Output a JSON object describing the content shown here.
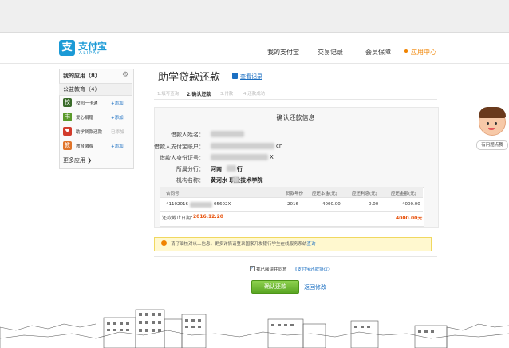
{
  "brand": {
    "logo_glyph": "支",
    "name": "支付宝",
    "sub": "ALIPAY",
    "color": "#1b9ad6"
  },
  "nav": [
    {
      "label": "我的支付宝"
    },
    {
      "label": "交易记录"
    },
    {
      "label": "会员保障"
    },
    {
      "label": "应用中心"
    }
  ],
  "sidebar": {
    "title": "我的应用（8）",
    "section": "公益教育（4）",
    "apps": [
      {
        "name": "校园一卡通",
        "action": "+添加",
        "icon": "card-icon",
        "color": "#3a6b2a",
        "glyph": "校"
      },
      {
        "name": "爱心捐赠",
        "action": "+添加",
        "icon": "book-icon",
        "color": "#5a9a2a",
        "glyph": "书"
      },
      {
        "name": "助学贷款还款",
        "action": "已添加",
        "icon": "heart-icon",
        "color": "#d23b2b",
        "glyph": "♥"
      },
      {
        "name": "教育缴费",
        "action": "+添加",
        "icon": "education-icon",
        "color": "#e0742a",
        "glyph": "教"
      }
    ],
    "more": "更多应用 ❯"
  },
  "page": {
    "title": "助学贷款还款",
    "record_link": "查看记录"
  },
  "steps": [
    "1.填写查询",
    "2.确认还款",
    "3.付款",
    "4.还款成功"
  ],
  "panel": {
    "title": "确认还款信息",
    "rows": [
      {
        "label": "借款人姓名：",
        "value": ""
      },
      {
        "label": "借款人支付宝账户：",
        "value": "cn"
      },
      {
        "label": "借款人身份证号：",
        "value": "X"
      },
      {
        "label": "所属分行：",
        "value": "河南"
      },
      {
        "label": "机构名称：",
        "value": "黄河水 职业技术学院"
      }
    ],
    "branch_suffix": "行"
  },
  "table": {
    "headers": [
      "合同号",
      "贷款年份",
      "应还本金(元)",
      "应还利息(元)",
      "应还金额(元)"
    ],
    "row": {
      "contract_a": "41102016",
      "contract_b": "05602X",
      "year": "2016",
      "principal": "4000.00",
      "interest": "0.00",
      "amount": "4000.00"
    },
    "deadline_label": "还款截止日期：",
    "deadline": "2016.12.20",
    "total": "4000.00元"
  },
  "notice": {
    "text": "请仔细核对以上信息，更多详情请登录国家开发银行学生在线服务系统",
    "link": "查询"
  },
  "agree": {
    "text": "我已阅读并同意",
    "link": "《支付宝还款协议》"
  },
  "buttons": {
    "confirm": "确认还款",
    "back": "返回修改"
  },
  "help": {
    "label": "有问题点我"
  },
  "colors": {
    "accent": "#f08300",
    "link": "#1b6fc2",
    "button": "#6bb52e",
    "amount": "#e8540f"
  }
}
